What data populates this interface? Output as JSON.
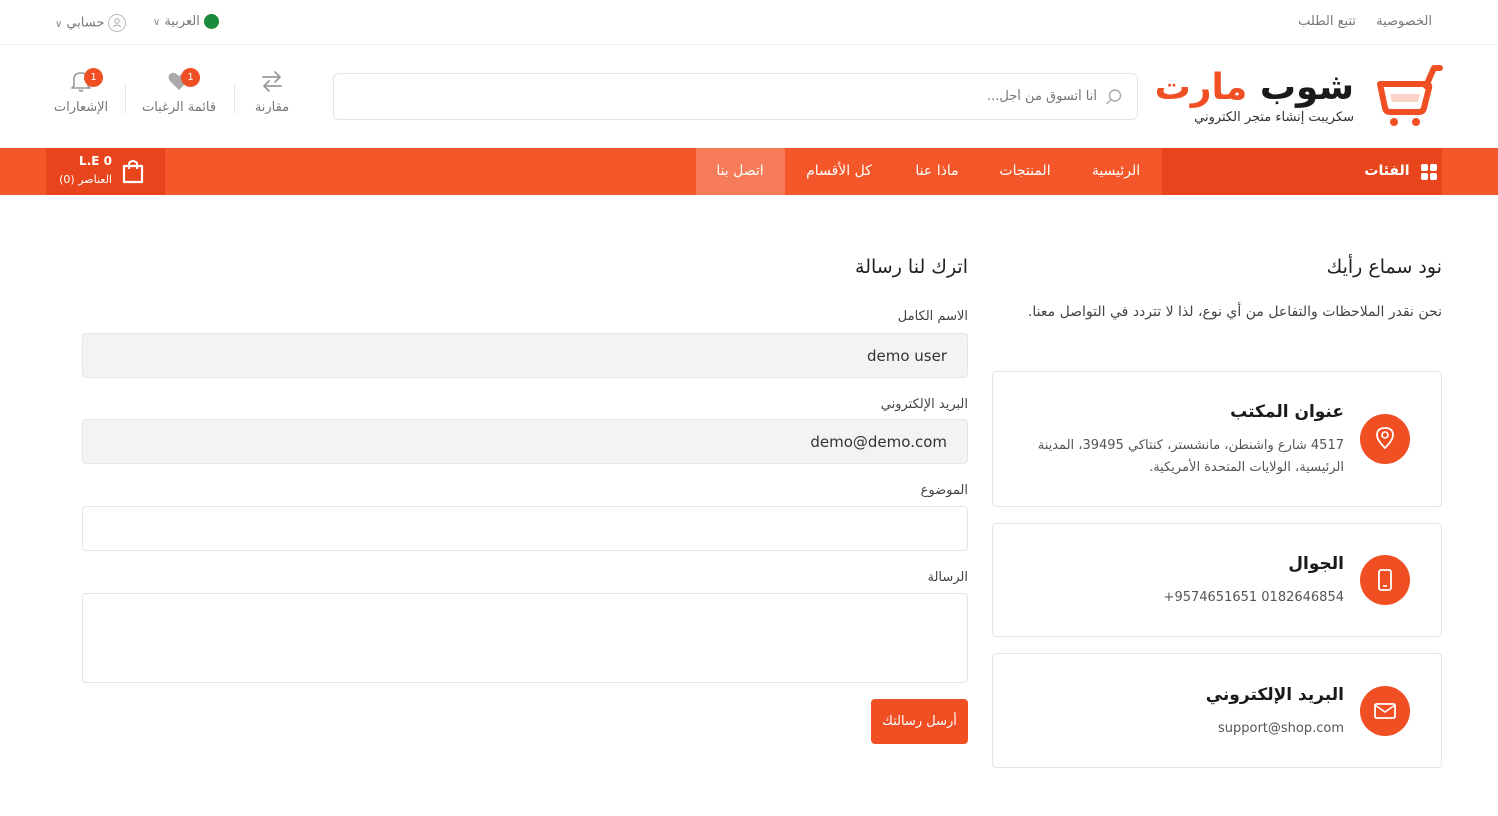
{
  "topbar": {
    "privacy": "الخصوصية",
    "track_order": "تتبع الطلب",
    "language": "العربية",
    "account": "حسابي"
  },
  "header": {
    "logo_part1": "شوب",
    "logo_part2": "مارت",
    "logo_subtitle": "سكريبت إنشاء متجر الكتروني",
    "search_placeholder": "أنا أتسوق من أجل...",
    "compare_label": "مقارنة",
    "wishlist_label": "قائمة الرغبات",
    "wishlist_count": "1",
    "notifications_label": "الإشعارات",
    "notifications_count": "1"
  },
  "nav": {
    "categories": "الفئات",
    "items": [
      "الرئيسية",
      "المنتجات",
      "ماذا عنا",
      "كل الأقسام",
      "اتصل بنا"
    ],
    "cart_amount": "0 L.E",
    "cart_items": "العناصر (0)"
  },
  "contact_info": {
    "title": "نود سماع رأيك",
    "intro": "نحن نقدر الملاحظات والتفاعل من أي نوع، لذا لا تتردد في التواصل معنا.",
    "cards": [
      {
        "title": "عنوان المكتب",
        "text": "4517 شارع واشنطن، مانشستر، كنتاكي 39495، المدينة الرئيسية، الولايات المتحدة الأمريكية.",
        "icon": "location-pin-icon"
      },
      {
        "title": "الجوال",
        "text": "+9574651651 0182646854",
        "icon": "mobile-phone-icon"
      },
      {
        "title": "البريد الإلكتروني",
        "text": "support@shop.com",
        "icon": "envelope-icon"
      }
    ]
  },
  "form": {
    "title": "اترك لنا رسالة",
    "name_label": "الاسم الكامل",
    "name_value": "demo user",
    "email_label": "البريد الإلكتروني",
    "email_value": "demo@demo.com",
    "subject_label": "الموضوع",
    "subject_value": "",
    "message_label": "الرسالة",
    "message_value": "",
    "submit_label": "أرسل رسالتك"
  },
  "colors": {
    "brand": "#f04e23",
    "nav": "#f4572a",
    "nav_dark": "#e8451c"
  }
}
